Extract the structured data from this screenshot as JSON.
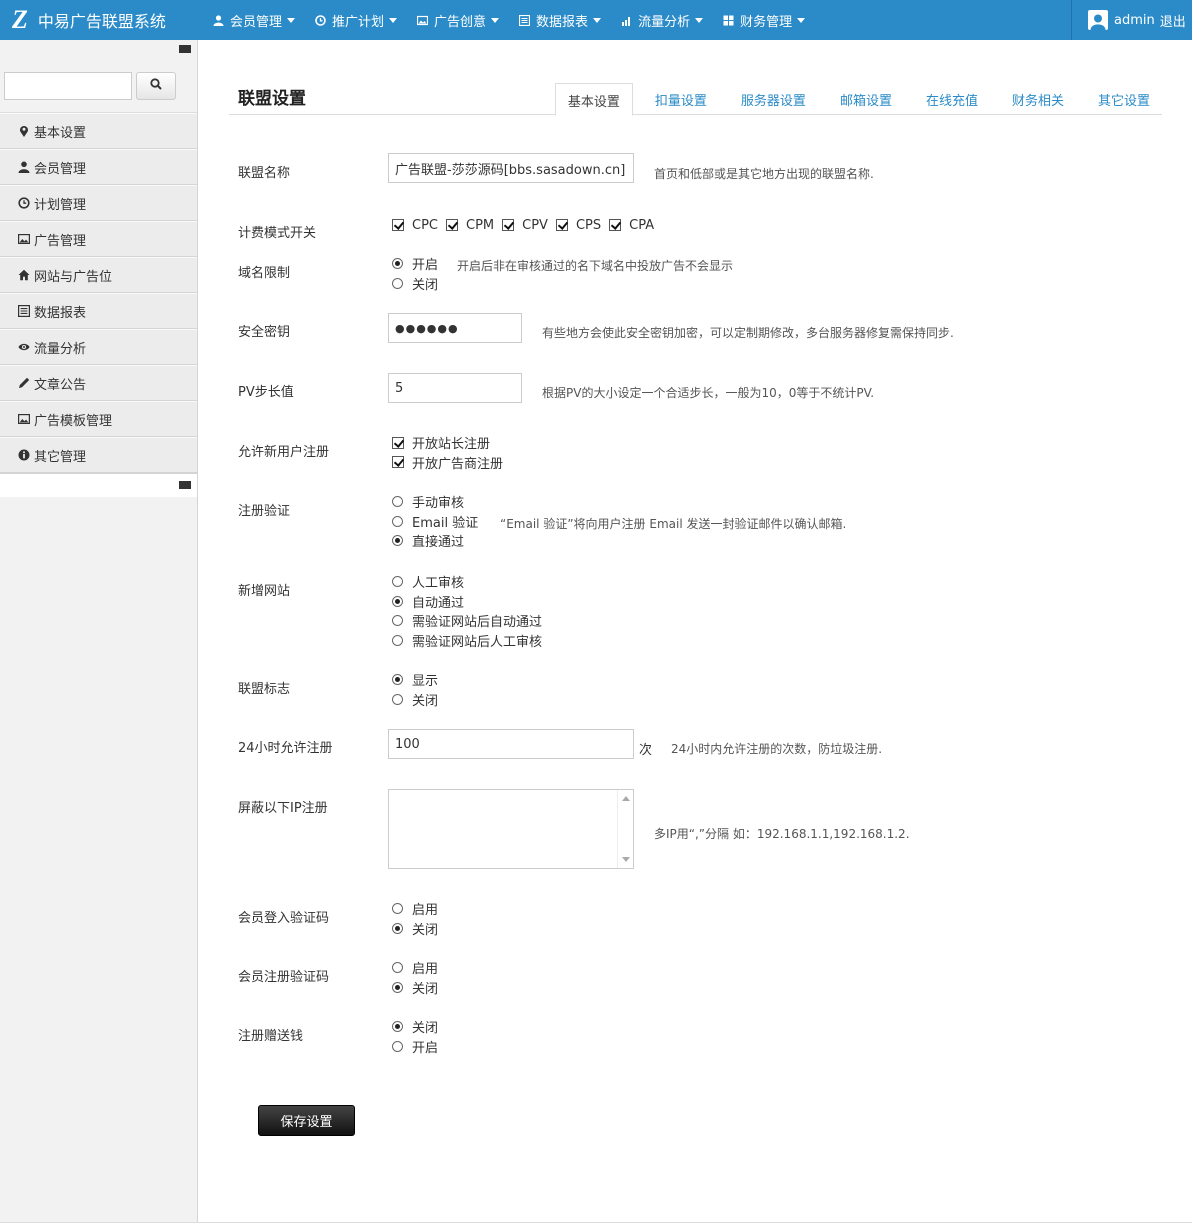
{
  "brand": {
    "logo": "Z",
    "name": "中易广告联盟系统"
  },
  "topnav": [
    {
      "label": "会员管理",
      "icon": "user-icon"
    },
    {
      "label": "推广计划",
      "icon": "clock-icon"
    },
    {
      "label": "广告创意",
      "icon": "picture-icon"
    },
    {
      "label": "数据报表",
      "icon": "list-icon"
    },
    {
      "label": "流量分析",
      "icon": "bar-chart-icon"
    },
    {
      "label": "财务管理",
      "icon": "gift-icon"
    }
  ],
  "user": {
    "name": "admin",
    "logout": "退出"
  },
  "sidebar": {
    "search_placeholder": "",
    "items": [
      {
        "label": "基本设置",
        "icon": "map-marker-icon"
      },
      {
        "label": "会员管理",
        "icon": "user-icon"
      },
      {
        "label": "计划管理",
        "icon": "clock-icon"
      },
      {
        "label": "广告管理",
        "icon": "picture-icon"
      },
      {
        "label": "网站与广告位",
        "icon": "home-icon"
      },
      {
        "label": "数据报表",
        "icon": "list-icon"
      },
      {
        "label": "流量分析",
        "icon": "eye-icon"
      },
      {
        "label": "文章公告",
        "icon": "pencil-icon"
      },
      {
        "label": "广告模板管理",
        "icon": "picture-icon"
      },
      {
        "label": "其它管理",
        "icon": "info-icon"
      }
    ]
  },
  "page": {
    "title": "联盟设置",
    "tabs": [
      "基本设置",
      "扣量设置",
      "服务器设置",
      "邮箱设置",
      "在线充值",
      "财务相关",
      "其它设置"
    ],
    "active_tab": "基本设置"
  },
  "form": {
    "site_name": {
      "label": "联盟名称",
      "value": "广告联盟-莎莎源码[bbs.sasadown.cn]",
      "help": "首页和低部或是其它地方出现的联盟名称."
    },
    "billing": {
      "label": "计费模式开关",
      "options": [
        "CPC",
        "CPM",
        "CPV",
        "CPS",
        "CPA"
      ]
    },
    "domain_limit": {
      "label": "域名限制",
      "options": [
        "开启",
        "关闭"
      ],
      "selected": "开启",
      "help": "开启后非在审核通过的名下域名中投放广告不会显示"
    },
    "secret_key": {
      "label": "安全密钥",
      "value": "●●●●●●",
      "help": "有些地方会使此安全密钥加密，可以定制期修改，多台服务器修复需保持同步."
    },
    "pv_step": {
      "label": "PV步长值",
      "value": "5",
      "help": "根据PV的大小设定一个合适步长，一般为10，0等于不统计PV."
    },
    "allow_register": {
      "label": "允许新用户注册",
      "options": [
        "开放站长注册",
        "开放广告商注册"
      ]
    },
    "register_verify": {
      "label": "注册验证",
      "options": [
        "手动审核",
        "Email 验证",
        "直接通过"
      ],
      "selected": "直接通过",
      "help": "“Email 验证”将向用户注册 Email 发送一封验证邮件以确认邮箱."
    },
    "new_site": {
      "label": "新增网站",
      "options": [
        "人工审核",
        "自动通过",
        "需验证网站后自动通过",
        "需验证网站后人工审核"
      ],
      "selected": "自动通过"
    },
    "union_logo": {
      "label": "联盟标志",
      "options": [
        "显示",
        "关闭"
      ],
      "selected": "显示"
    },
    "reg_limit": {
      "label": "24小时允许注册",
      "value": "100",
      "unit": "次",
      "help": "24小时内允许注册的次数，防垃圾注册."
    },
    "block_ip": {
      "label": "屏蔽以下IP注册",
      "value": "",
      "help": "多IP用“,”分隔 如：192.168.1.1,192.168.1.2."
    },
    "login_captcha": {
      "label": "会员登入验证码",
      "options": [
        "启用",
        "关闭"
      ],
      "selected": "关闭"
    },
    "register_captcha": {
      "label": "会员注册验证码",
      "options": [
        "启用",
        "关闭"
      ],
      "selected": "关闭"
    },
    "register_bonus": {
      "label": "注册赠送钱",
      "options": [
        "关闭",
        "开启"
      ],
      "selected": "关闭"
    },
    "save_label": "保存设置"
  },
  "colors": {
    "topbar": "#2a8bc8",
    "link": "#2a8bc8",
    "save_button": "#222222"
  }
}
